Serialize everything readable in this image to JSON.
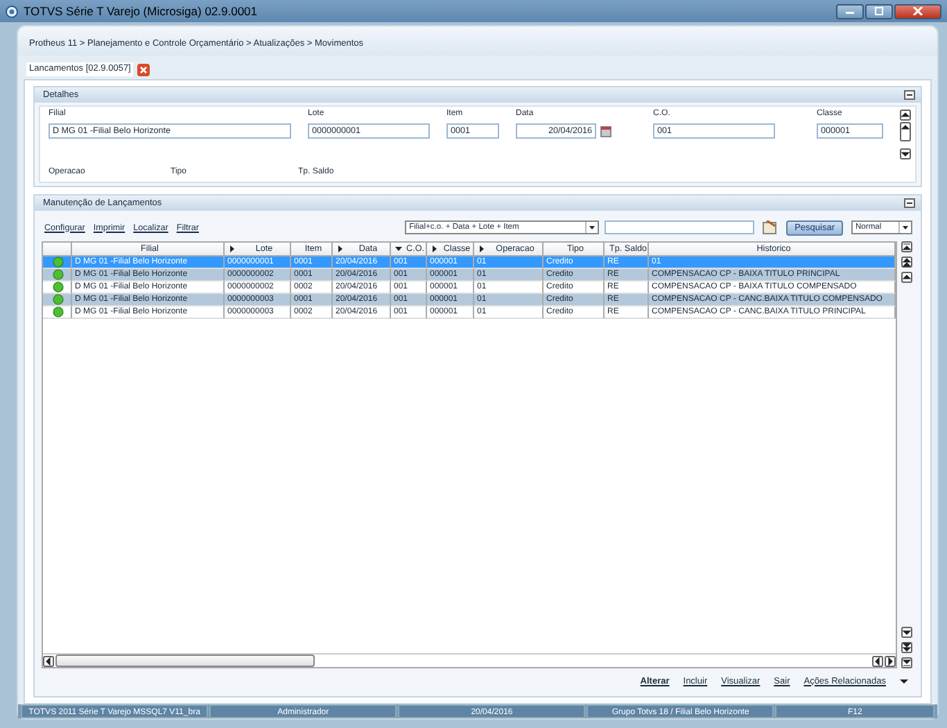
{
  "window": {
    "title": "TOTVS Série T Varejo (Microsiga) 02.9.0001"
  },
  "breadcrumb": "Protheus 11 > Planejamento e Controle Orçamentário > Atualizações > Movimentos",
  "tabs": [
    {
      "label": "Lancamentos [02.9.0057]",
      "selected": true
    }
  ],
  "details": {
    "title": "Detalhes",
    "fields": [
      {
        "label": "Filial",
        "value": "D MG 01 -Filial Belo Horizonte",
        "kind": "text"
      },
      {
        "label": "Lote",
        "value": "0000000001",
        "kind": "text"
      },
      {
        "label": "Item",
        "value": "0001",
        "kind": "text"
      },
      {
        "label": "Data",
        "value": "20/04/2016",
        "kind": "date"
      },
      {
        "label": "C.O.",
        "value": "001",
        "kind": "text"
      },
      {
        "label": "Classe",
        "value": "000001",
        "kind": "text"
      }
    ],
    "labels": [
      "Operacao",
      "Tipo",
      "Tp. Saldo"
    ]
  },
  "grid_panel": {
    "title": "Manutenção de Lançamentos",
    "links": [
      "Configurar",
      "Imprimir",
      "Localizar",
      "Filtrar"
    ],
    "index": "Filial+c.o. + Data + Lote + Item",
    "search_button": "Pesquisar",
    "view": "Normal",
    "columns": [
      {
        "label": "Filial",
        "kind": "plain"
      },
      {
        "label": "Lote",
        "kind": "indexed"
      },
      {
        "label": "Item",
        "kind": "plain"
      },
      {
        "label": "Data",
        "kind": "indexed"
      },
      {
        "label": "C.O.",
        "kind": "sorted"
      },
      {
        "label": "Classe",
        "kind": "indexed"
      },
      {
        "label": "Operacao",
        "kind": "indexed"
      },
      {
        "label": "Tipo",
        "kind": "plain"
      },
      {
        "label": "Tp. Saldo",
        "kind": "plain"
      },
      {
        "label": "Historico",
        "kind": "plain"
      }
    ],
    "rows": [
      {
        "selected": true,
        "cells": [
          "D MG 01 -Filial Belo Horizonte",
          "0000000001",
          "0001",
          "20/04/2016",
          "001",
          "000001",
          "01",
          "Credito",
          "RE",
          "01"
        ]
      },
      {
        "selected": false,
        "cells": [
          "D MG 01 -Filial Belo Horizonte",
          "0000000002",
          "0001",
          "20/04/2016",
          "001",
          "000001",
          "01",
          "Credito",
          "RE",
          "COMPENSACAO CP - BAIXA TITULO PRINCIPAL"
        ]
      },
      {
        "selected": false,
        "cells": [
          "D MG 01 -Filial Belo Horizonte",
          "0000000002",
          "0002",
          "20/04/2016",
          "001",
          "000001",
          "01",
          "Credito",
          "RE",
          "COMPENSACAO CP - BAIXA TITULO COMPENSADO"
        ]
      },
      {
        "selected": false,
        "cells": [
          "D MG 01 -Filial Belo Horizonte",
          "0000000003",
          "0001",
          "20/04/2016",
          "001",
          "000001",
          "01",
          "Credito",
          "RE",
          "COMPENSACAO CP - CANC.BAIXA TITULO COMPENSADO"
        ]
      },
      {
        "selected": false,
        "cells": [
          "D MG 01 -Filial Belo Horizonte",
          "0000000003",
          "0002",
          "20/04/2016",
          "001",
          "000001",
          "01",
          "Credito",
          "RE",
          "COMPENSACAO CP - CANC.BAIXA TITULO PRINCIPAL"
        ]
      }
    ],
    "actions": [
      "Alterar",
      "Incluir",
      "Visualizar",
      "Sair",
      "Ações Relacionadas"
    ]
  },
  "status_bar": [
    "TOTVS 2011 Série T Varejo MSSQL7 V11_bra",
    "Administrador",
    "20/04/2016",
    "Grupo Totvs 18 / Filial Belo Horizonte",
    "F12"
  ]
}
